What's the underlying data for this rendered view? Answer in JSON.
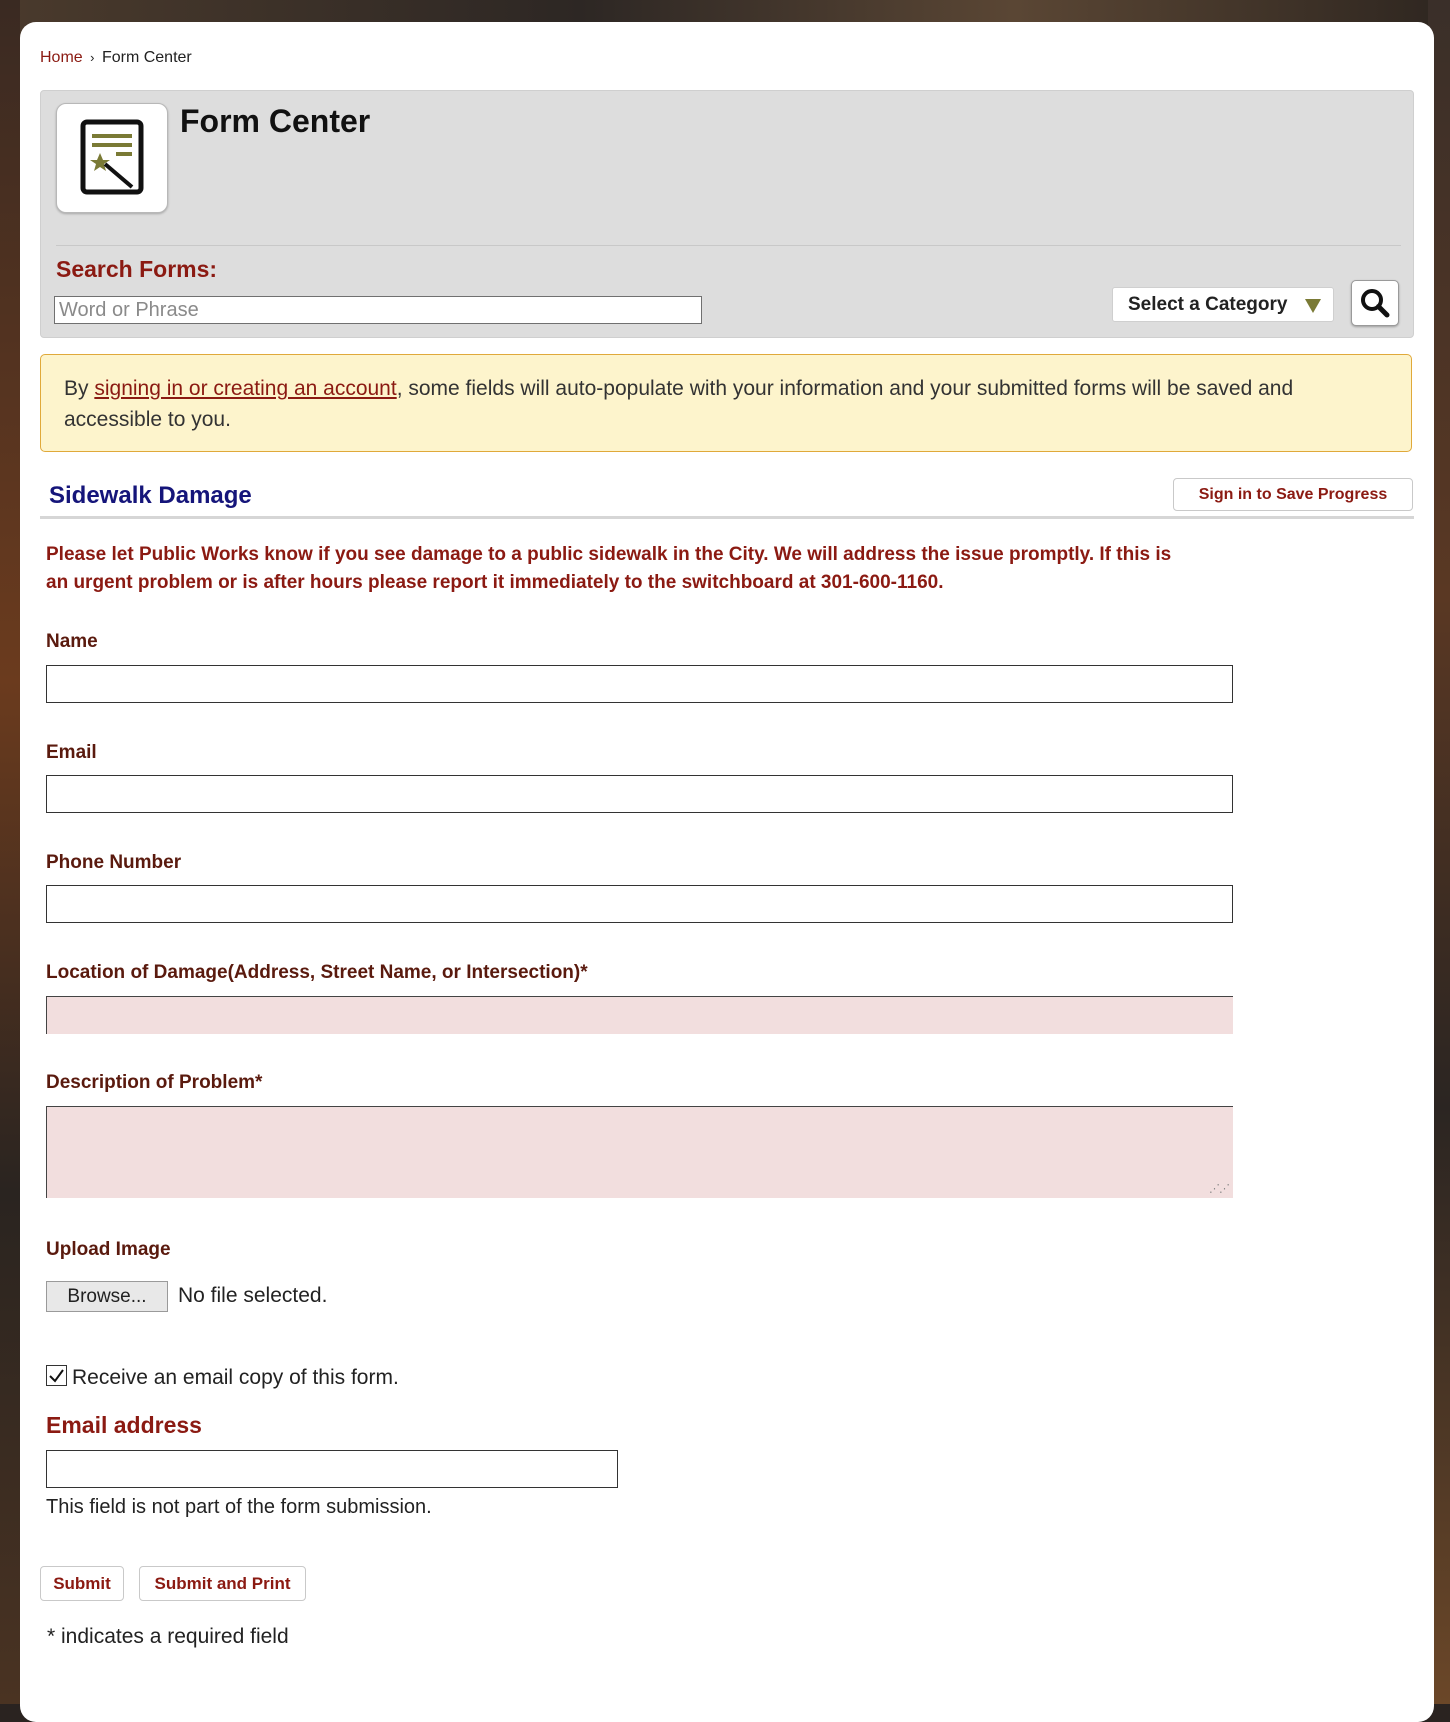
{
  "breadcrumb": {
    "home": "Home",
    "separator": "›",
    "current": "Form Center"
  },
  "header": {
    "title": "Form Center",
    "icon": "form-wand-icon",
    "search_label": "Search Forms:",
    "search_placeholder": "Word or Phrase",
    "category_select": "Select a Category",
    "search_button_icon": "magnifier-icon"
  },
  "notice": {
    "prefix": "By ",
    "link": "signing in or creating an account",
    "suffix": ", some fields will auto-populate with your information and your submitted forms will be saved and accessible to you."
  },
  "form": {
    "title": "Sidewalk Damage",
    "save_progress": "Sign in to Save Progress",
    "intro": "Please let Public Works know if you see damage to a public sidewalk in the City. We will address the issue promptly. If this is an urgent problem or is after hours please report it immediately to the switchboard at 301-600-1160.",
    "fields": {
      "name": {
        "label": "Name",
        "value": ""
      },
      "email": {
        "label": "Email",
        "value": ""
      },
      "phone": {
        "label": "Phone Number",
        "value": ""
      },
      "location": {
        "label": "Location of Damage(Address, Street Name, or Intersection)*",
        "value": ""
      },
      "description": {
        "label": "Description of Problem*",
        "value": ""
      }
    },
    "upload": {
      "label": "Upload Image",
      "button": "Browse...",
      "status": "No file selected."
    },
    "email_copy": {
      "checkbox_label": "Receive an email copy of this form.",
      "checked": true,
      "address_label": "Email address",
      "value": "",
      "note": "This field is not part of the form submission."
    },
    "buttons": {
      "submit": "Submit",
      "submit_print": "Submit and Print"
    },
    "required_note": "* indicates a required field"
  },
  "colors": {
    "accent": "#8b1a12",
    "title_blue": "#15157a",
    "required_bg": "#f2dede",
    "notice_bg": "#fdf4cc",
    "notice_border": "#e0a93a",
    "icon_olive": "#7a7a35"
  }
}
